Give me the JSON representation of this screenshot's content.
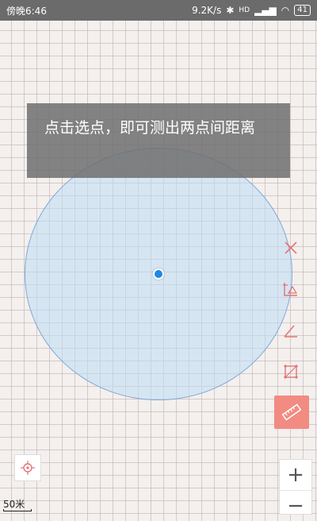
{
  "status": {
    "time": "傍晚6:46",
    "speed": "9.2K/s",
    "signal": "HD",
    "battery": "41"
  },
  "tip": {
    "text": "点击选点，即可测出两点间距离"
  },
  "tools": [
    {
      "name": "clear",
      "icon": "close-icon"
    },
    {
      "name": "area",
      "icon": "area-measure-icon"
    },
    {
      "name": "angle",
      "icon": "angle-icon"
    },
    {
      "name": "polygon",
      "icon": "polygon-icon"
    },
    {
      "name": "distance",
      "icon": "ruler-icon"
    }
  ],
  "zoom": {
    "plus": "+",
    "minus": "−"
  },
  "scale": {
    "label": "50米"
  },
  "colors": {
    "accent": "#e57373",
    "dot": "#1e88e5",
    "circle_fill": "#bedcf5"
  }
}
